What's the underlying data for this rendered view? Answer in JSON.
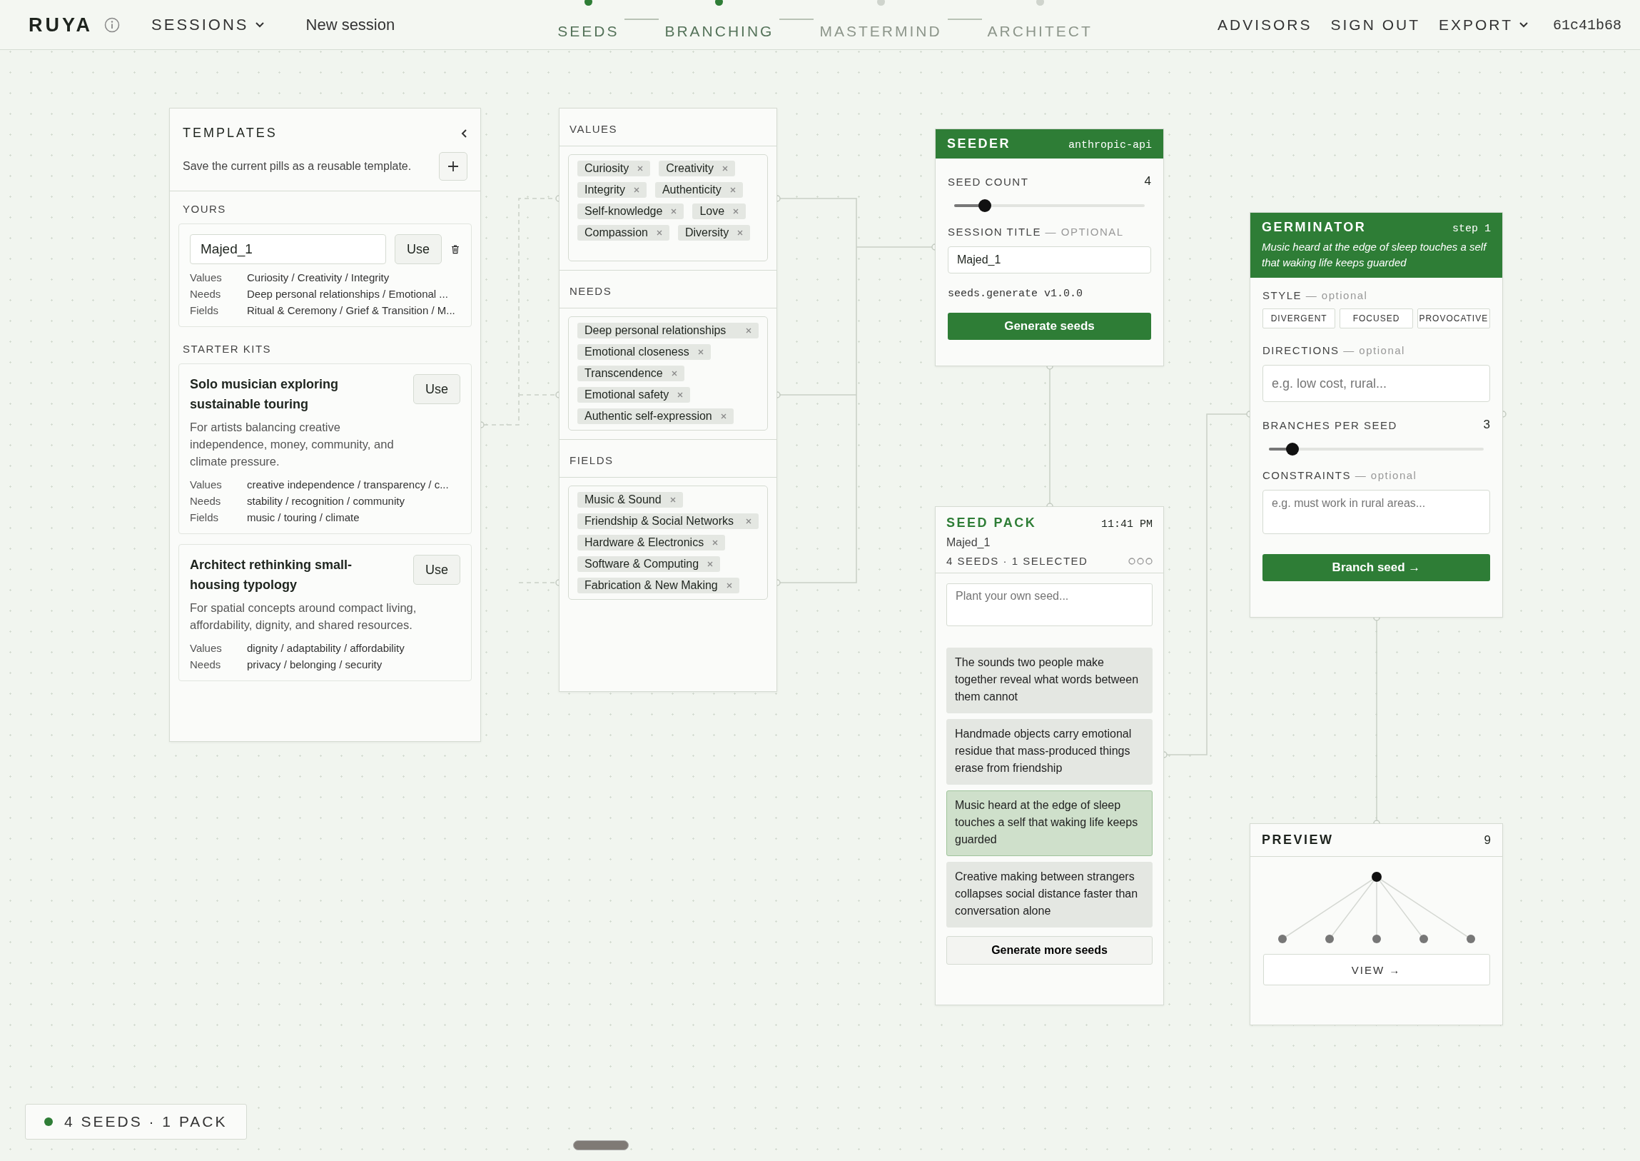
{
  "header": {
    "logo": "RUYA",
    "sessions": "SESSIONS",
    "session_name": "New session",
    "steps": [
      {
        "label": "SEEDS",
        "reached": true
      },
      {
        "label": "BRANCHING",
        "reached": true
      },
      {
        "label": "MASTERMIND",
        "reached": false
      },
      {
        "label": "ARCHITECT",
        "reached": false
      }
    ],
    "nav": [
      "ADVISORS",
      "SIGN OUT"
    ],
    "export": "EXPORT",
    "session_id": "61c41b68"
  },
  "templates": {
    "title": "TEMPLATES",
    "hint": "Save the current pills as a reusable template.",
    "yours_label": "YOURS",
    "yours": [
      {
        "name": "Majed_1",
        "use": "Use",
        "rows": [
          {
            "label": "Values",
            "value": "Curiosity / Creativity / Integrity"
          },
          {
            "label": "Needs",
            "value": "Deep personal relationships / Emotional ..."
          },
          {
            "label": "Fields",
            "value": "Ritual & Ceremony / Grief & Transition / M..."
          }
        ]
      }
    ],
    "kits_label": "STARTER KITS",
    "kits": [
      {
        "title": "Solo musician exploring sustainable touring",
        "description": "For artists balancing creative independence, money, community, and climate pressure.",
        "use": "Use",
        "rows": [
          {
            "label": "Values",
            "value": "creative independence / transparency / c..."
          },
          {
            "label": "Needs",
            "value": "stability / recognition / community"
          },
          {
            "label": "Fields",
            "value": "music / touring / climate"
          }
        ]
      },
      {
        "title": "Architect rethinking small-housing typology",
        "description": "For spatial concepts around compact living, affordability, dignity, and shared resources.",
        "use": "Use",
        "rows": [
          {
            "label": "Values",
            "value": "dignity / adaptability / affordability"
          },
          {
            "label": "Needs",
            "value": "privacy / belonging / security"
          }
        ]
      }
    ]
  },
  "pills": {
    "groups": [
      {
        "title": "VALUES",
        "items": [
          "Curiosity",
          "Creativity",
          "Integrity",
          "Authenticity",
          "Self-knowledge",
          "Love",
          "Compassion",
          "Diversity"
        ]
      },
      {
        "title": "NEEDS",
        "items": [
          "Deep personal relationships",
          "Emotional closeness",
          "Transcendence",
          "Emotional safety",
          "Authentic self-expression"
        ]
      },
      {
        "title": "FIELDS",
        "items": [
          "Music & Sound",
          "Friendship & Social Networks",
          "Hardware & Electronics",
          "Software & Computing",
          "Fabrication & New Making"
        ]
      }
    ]
  },
  "seeder": {
    "title": "SEEDER",
    "provider": "anthropic-api",
    "seed_count_label": "SEED COUNT",
    "seed_count": "4",
    "level": 0.16,
    "session_title_label": "SESSION TITLE",
    "optional": "— OPTIONAL",
    "session_title": "Majed_1",
    "version": "seeds.generate v1.0.0",
    "button": "Generate seeds"
  },
  "seed_pack": {
    "title": "SEED PACK",
    "time": "11:41 PM",
    "name": "Majed_1",
    "summary": "4 SEEDS · 1 SELECTED",
    "placeholder": "Plant your own seed...",
    "seeds": [
      {
        "text": "The sounds two people make together reveal what words between them cannot",
        "selected": false
      },
      {
        "text": "Handmade objects carry emotional residue that mass-produced things erase from friendship",
        "selected": false
      },
      {
        "text": "Music heard at the edge of sleep touches a self that waking life keeps guarded",
        "selected": true
      },
      {
        "text": "Creative making between strangers collapses social distance faster than conversation alone",
        "selected": false
      }
    ],
    "button": "Generate more seeds"
  },
  "germinator": {
    "title": "GERMINATOR",
    "step": "step 1",
    "seed": "Music heard at the edge of sleep touches a self that waking life keeps guarded",
    "style_label": "STYLE",
    "style_optional": "— optional",
    "styles": [
      {
        "label": "DIVERGENT",
        "selected": false
      },
      {
        "label": "FOCUSED",
        "selected": false
      },
      {
        "label": "PROVOCATIVE",
        "selected": false
      }
    ],
    "directions_label": "DIRECTIONS",
    "directions_optional": "— optional",
    "directions_placeholder": "e.g. low cost, rural...",
    "branches_label": "BRANCHES PER SEED",
    "branches": "3",
    "level": 0.11,
    "constraints_label": "CONSTRAINTS",
    "constraints_optional": "— optional",
    "constraints_placeholder": "e.g. must work in rural areas...",
    "button": "Branch seed →"
  },
  "preview": {
    "title": "PREVIEW",
    "count": "9",
    "button": "VIEW →"
  },
  "status": {
    "text": "4 SEEDS · 1 PACK"
  }
}
